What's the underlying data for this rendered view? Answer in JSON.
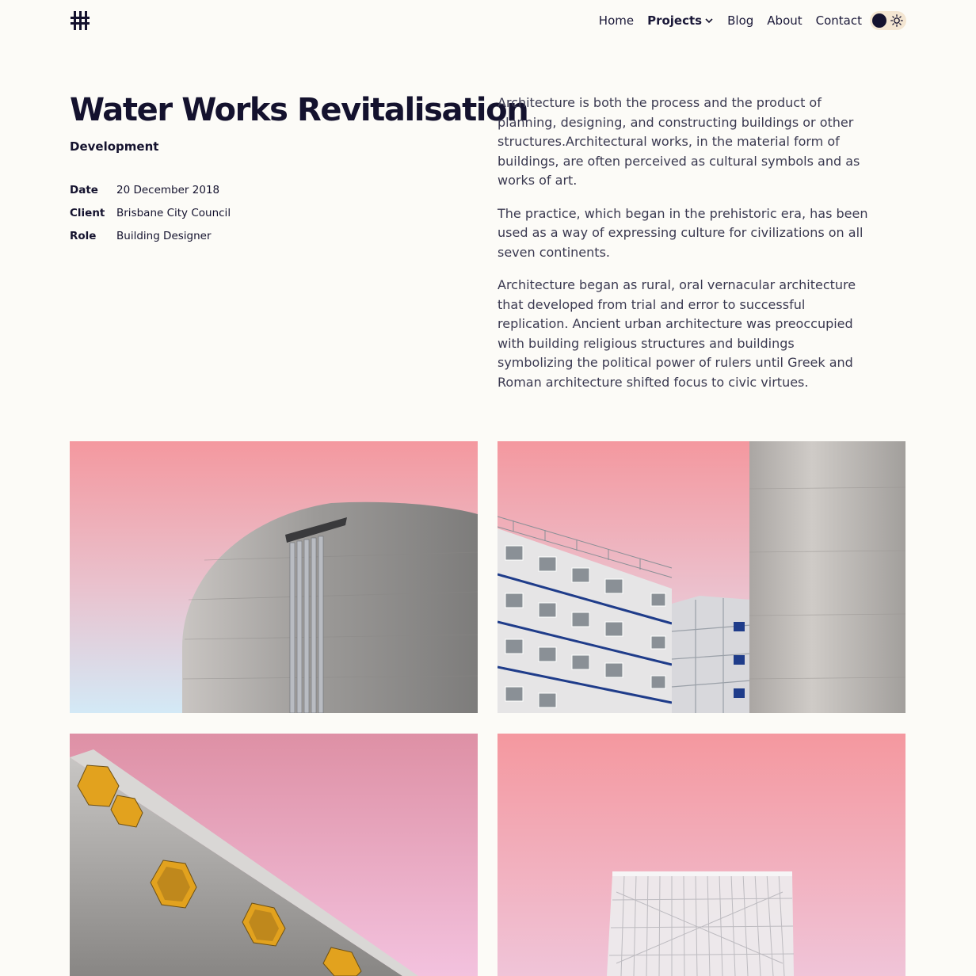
{
  "nav": {
    "items": [
      {
        "label": "Home"
      },
      {
        "label": "Projects"
      },
      {
        "label": "Blog"
      },
      {
        "label": "About"
      },
      {
        "label": "Contact"
      }
    ],
    "active": "Projects"
  },
  "project": {
    "title": "Water Works Revitalisation",
    "category": "Development",
    "meta": [
      {
        "key": "Date",
        "value": "20 December 2018"
      },
      {
        "key": "Client",
        "value": "Brisbane City Council"
      },
      {
        "key": "Role",
        "value": "Building Designer"
      }
    ],
    "paragraphs": [
      "Architecture is both the process and the product of planning, designing, and constructing buildings or other structures.Architectural works, in the material form of buildings, are often perceived as cultural symbols and as works of art.",
      "The practice, which began in the prehistoric era, has been used as a way of expressing culture for civilizations on all seven continents.",
      "Architecture began as rural, oral vernacular architecture that developed from trial and error to successful replication. Ancient urban architecture was preoccupied with building religious structures and buildings symbolizing the political power of rulers until Greek and Roman architecture shifted focus to civic virtues."
    ]
  },
  "gallery": [
    {
      "subject": "concrete silo with pipes"
    },
    {
      "subject": "modular building beside silo"
    },
    {
      "subject": "concrete tube with hexagonal windows"
    },
    {
      "subject": "white lattice structure"
    }
  ],
  "colors": {
    "background": "#fcfbf7",
    "text": "#14122e",
    "body_text": "#3a3950",
    "sky_pink": "#f4989f",
    "toggle_bg": "#f4e6d2"
  },
  "icons": {
    "logo": "hash-logo-icon",
    "dropdown": "chevron-down-icon",
    "theme_dark": "moon-dot-icon",
    "theme_light": "sun-icon"
  }
}
